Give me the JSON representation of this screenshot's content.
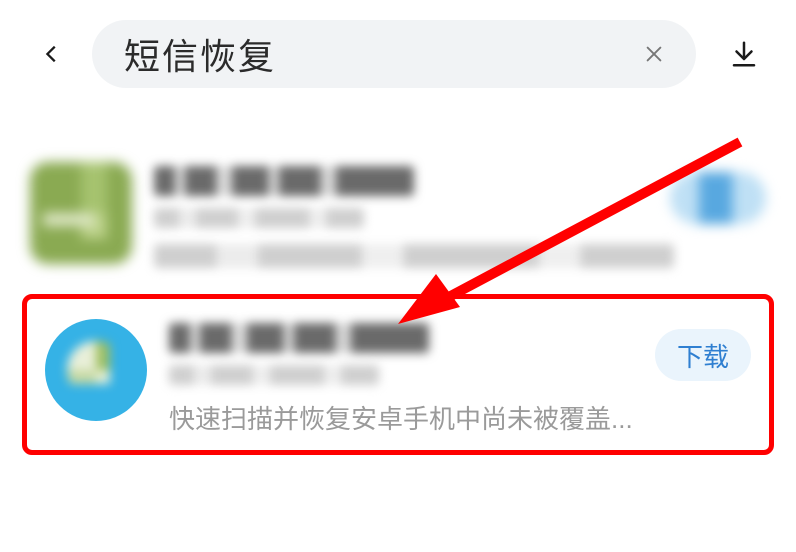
{
  "header": {
    "search_value": "短信恢复"
  },
  "results": [
    {
      "action_label": "",
      "description": ""
    },
    {
      "action_label": "下载",
      "description": "快速扫描并恢复安卓手机中尚未被覆盖..."
    }
  ]
}
